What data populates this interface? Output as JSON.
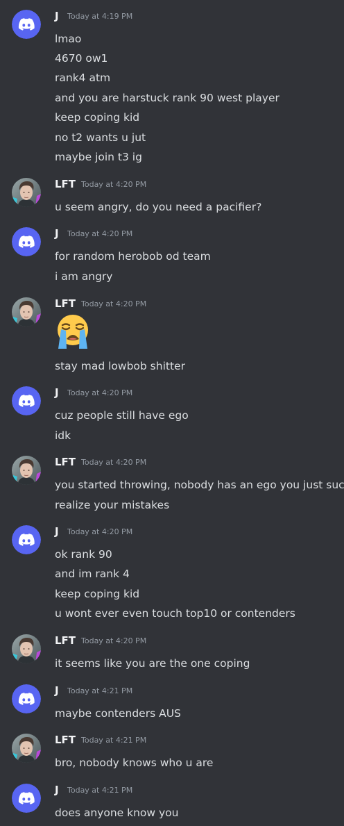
{
  "messages": [
    {
      "author": "J",
      "time": "Today at 4:19 PM",
      "avatar": "discord-logo-avatar",
      "lines": [
        "lmao",
        "4670 ow1",
        "rank4 atm",
        "and you are harstuck rank 90 west player",
        "keep coping kid",
        "no t2 wants u jut",
        "maybe join t3 ig"
      ]
    },
    {
      "author": "LFT",
      "time": "Today at 4:20 PM",
      "avatar": "user-photo-avatar",
      "lines": [
        "u seem angry, do you need a pacifier?"
      ]
    },
    {
      "author": "J",
      "time": "Today at 4:20 PM",
      "avatar": "discord-logo-avatar",
      "lines": [
        "for random herobob od team",
        "i am angry"
      ]
    },
    {
      "author": "LFT",
      "time": "Today at 4:20 PM",
      "avatar": "user-photo-avatar",
      "emoji": "loudly-crying-face-emoji",
      "lines": [
        "stay mad lowbob shitter"
      ]
    },
    {
      "author": "J",
      "time": "Today at 4:20 PM",
      "avatar": "discord-logo-avatar",
      "lines": [
        "cuz people still have ego",
        "idk"
      ]
    },
    {
      "author": "LFT",
      "time": "Today at 4:20 PM",
      "avatar": "user-photo-avatar",
      "lines": [
        "you started throwing, nobody has an ego you just suck",
        "realize your mistakes"
      ]
    },
    {
      "author": "J",
      "time": "Today at 4:20 PM",
      "avatar": "discord-logo-avatar",
      "lines": [
        "ok rank 90",
        "and im rank 4",
        "keep coping kid",
        "u wont ever even touch top10 or contenders"
      ]
    },
    {
      "author": "LFT",
      "time": "Today at 4:20 PM",
      "avatar": "user-photo-avatar",
      "lines": [
        "it seems like you are the one coping"
      ]
    },
    {
      "author": "J",
      "time": "Today at 4:21 PM",
      "avatar": "discord-logo-avatar",
      "lines": [
        "maybe contenders AUS"
      ]
    },
    {
      "author": "LFT",
      "time": "Today at 4:21 PM",
      "avatar": "user-photo-avatar",
      "lines": [
        "bro, nobody knows who u are"
      ]
    },
    {
      "author": "J",
      "time": "Today at 4:21 PM",
      "avatar": "discord-logo-avatar",
      "lines": [
        "does anyone know you"
      ]
    }
  ],
  "colors": {
    "background": "#313338",
    "discord_blurple": "#5865f2",
    "username": "#f2f3f5",
    "timestamp": "#949ba4",
    "message_text": "#dbdee1"
  }
}
